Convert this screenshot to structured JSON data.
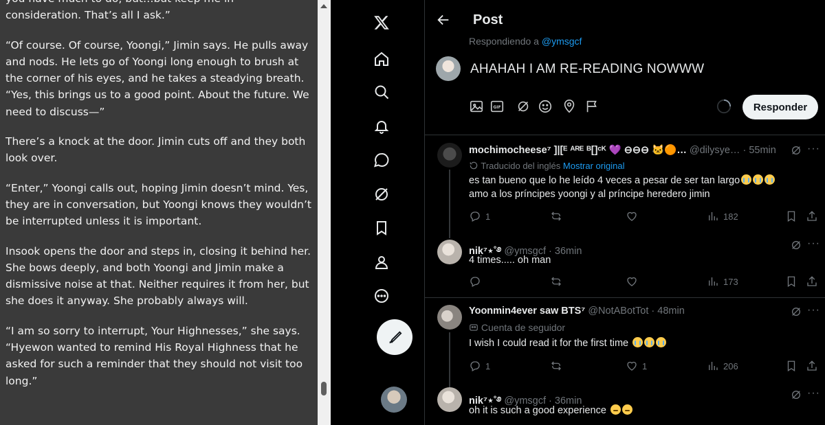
{
  "reader": {
    "paragraphs": [
      "you have much to do, but…but keep me in consideration. That’s all I ask.”",
      "“Of course. Of course, Yoongi,” Jimin says. He pulls away and nods. He lets go of Yoongi long enough to brush at the corner of his eyes, and he takes a steadying breath. “Yes, this brings us to a good point. About the future. We need to discuss—”",
      "There’s a knock at the door. Jimin cuts off and they both look over.",
      "“Enter,” Yoongi calls out, hoping Jimin doesn’t mind. Yes, they are in conversation, but Yoongi knows they wouldn’t be interrupted unless it is important.",
      "Insook opens the door and steps in, closing it behind her. She bows deeply, and both Yoongi and Jimin make a dismissive noise at that. Neither requires it from her, but she does it anyway. She probably always will.",
      "“I am so sorry to interrupt, Your Highnesses,” she says. “Hyewon wanted to remind His Royal Highness that he asked for such a reminder that they should not visit too long.”"
    ]
  },
  "nav": {
    "items": [
      "x-logo",
      "home",
      "explore",
      "notifications",
      "messages",
      "grok",
      "bookmarks",
      "profile",
      "more"
    ]
  },
  "header": {
    "title": "Post"
  },
  "composer": {
    "replying_prefix": "Respondiendo a",
    "replying_handle": "@ymsgcf",
    "text": "AHAHAH I AM RE-READING NOWWW",
    "reply_button": "Responder"
  },
  "tweets": [
    {
      "name": "mochimocheese⁷ ]|[ᴱ ᴬᴿᴱ ᴮ[]ᶜᴷ 💜 ⊖⊖⊖ 🐱🟠…",
      "handle": "@dilysye…",
      "time": "55min",
      "note_prefix": "Traducido del inglés",
      "note_link": "Mostrar original",
      "text": "es tan bueno que lo he leído 4 veces a pesar de ser tan largo",
      "text_tail": "amo a los príncipes yoongi y al príncipe heredero jimin",
      "replies": "1",
      "reposts": "",
      "likes": "",
      "views": "182"
    },
    {
      "name": "nik⁷⋆˚࿔",
      "handle": "@ymsgcf",
      "time": "36min",
      "text": "4 times..... oh man",
      "replies": "",
      "reposts": "",
      "likes": "",
      "views": "173"
    },
    {
      "name": "Yoonmin4ever saw BTS⁷",
      "handle": "@NotABotTot",
      "time": "48min",
      "note_prefix": "Cuenta de seguidor",
      "text": "I wish I could read it for the first time",
      "replies": "1",
      "reposts": "",
      "likes": "1",
      "views": "206"
    },
    {
      "name": "nik⁷⋆˚࿔",
      "handle": "@ymsgcf",
      "time": "36min",
      "text": "oh it is such a good experience"
    }
  ],
  "colors": {
    "accent": "#1d9bf0",
    "muted": "#71767b",
    "text": "#e7e9ea",
    "border": "#2f3336"
  }
}
